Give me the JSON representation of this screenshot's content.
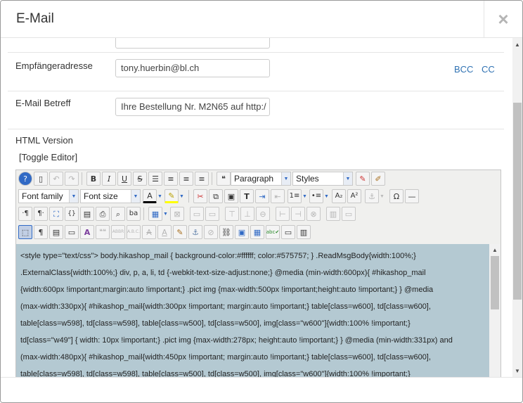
{
  "modal": {
    "title": "E-Mail",
    "close_label": "×"
  },
  "form": {
    "recipient": {
      "label": "Empfängeradresse",
      "value": "tony.huerbin@bl.ch",
      "bcc_label": "BCC",
      "cc_label": "CC"
    },
    "subject": {
      "label": "E-Mail Betreff",
      "value": "Ihre Bestellung Nr. M2N65 auf http:/"
    },
    "html_version_label": "HTML Version",
    "toggle_editor_label": "[Toggle Editor]"
  },
  "toolbar": {
    "format_select": "Paragraph",
    "styles_select": "Styles",
    "font_family_select": "Font family",
    "font_size_select": "Font size",
    "bold": "B",
    "italic": "I",
    "underline": "U",
    "strikethrough": "S",
    "quote": "❝",
    "omega": "Ω",
    "hr": "—",
    "subscript": "A₂",
    "superscript": "A²",
    "font_color": "A",
    "ltr": "¶",
    "rtl": "¶",
    "paragraph": "¶",
    "spell_check": "abc",
    "help": "?"
  },
  "editor": {
    "content_lines": [
      "<style type=\"text/css\"> body.hikashop_mail { background-color:#ffffff; color:#575757; } .ReadMsgBody{width:100%;}",
      ".ExternalClass{width:100%;} div, p, a, li, td {-webkit-text-size-adjust:none;} @media (min-width:600px){ #hikashop_mail",
      "{width:600px !important;margin:auto !important;} .pict img {max-width:500px !important;height:auto !important;} } @media",
      "(max-width:330px){ #hikashop_mail{width:300px !important; margin:auto !important;} table[class=w600], td[class=w600],",
      "table[class=w598], td[class=w598], table[class=w500], td[class=w500], img[class=\"w600\"]{width:100% !important;}",
      "td[class=\"w49\"] { width: 10px !important;} .pict img {max-width:278px; height:auto !important;} } @media (min-width:331px) and",
      "(max-width:480px){ #hikashop_mail{width:450px !important; margin:auto !important;} table[class=w600], td[class=w600],",
      "table[class=w598], td[class=w598], table[class=w500], td[class=w500], img[class=\"w600\"]{width:100% !important;}"
    ]
  },
  "colors": {
    "link": "#3072b3",
    "content_bg": "#b4c9d2",
    "toolbar_bg": "#f0f0ee"
  }
}
